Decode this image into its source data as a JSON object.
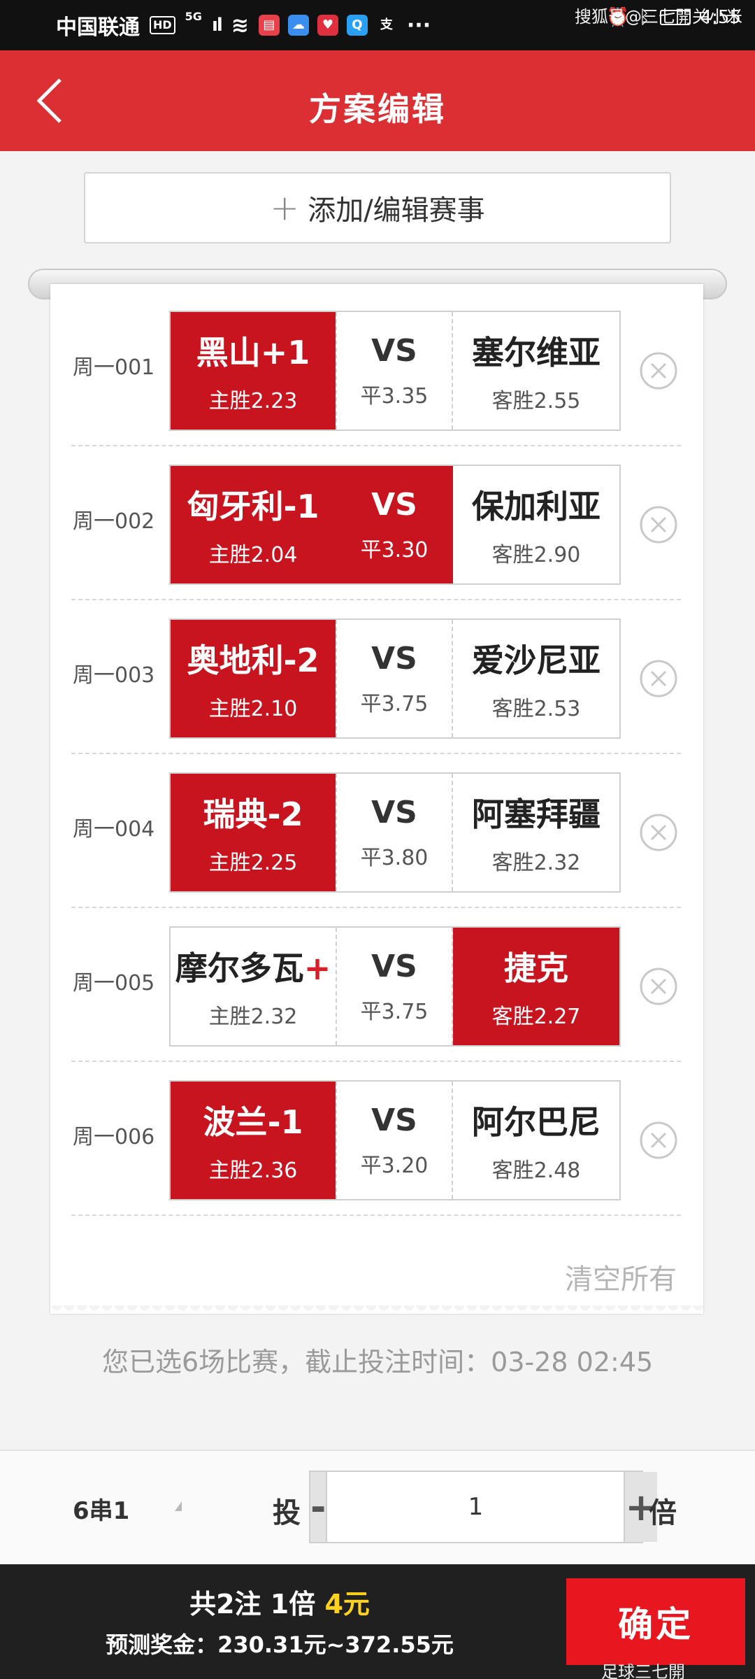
{
  "status_bar": {
    "carrier": "中国联通",
    "hd_badge": "HD",
    "network": "5G",
    "signal": "ıl",
    "wifi": "≋",
    "time": "4:55",
    "watermark": "搜狐号@三七開关小米",
    "apps": [
      {
        "name": "book-app-icon",
        "glyph": "▤",
        "color": "#e8404a"
      },
      {
        "name": "cloud-app-icon",
        "glyph": "☁",
        "color": "#3a8ef0"
      },
      {
        "name": "heart-app-icon",
        "glyph": "♥",
        "color": "#e03040"
      },
      {
        "name": "search-app-icon",
        "glyph": "Q",
        "color": "#2aa0f5"
      },
      {
        "name": "alipay-app-icon",
        "glyph": "支",
        "color": "#111111"
      }
    ],
    "more": "···"
  },
  "header": {
    "title": "方案编辑"
  },
  "add_button": {
    "plus": "+",
    "label": "添加/编辑赛事"
  },
  "matches": [
    {
      "no": "周一001",
      "home": "黑山",
      "handicap": "+1",
      "home_odd": "主胜2.23",
      "vs": "VS",
      "draw_odd": "平3.35",
      "away": "塞尔维亚",
      "away_odd": "客胜2.55",
      "sel_home": true,
      "sel_draw": false,
      "sel_away": false
    },
    {
      "no": "周一002",
      "home": "匈牙利",
      "handicap": "-1",
      "home_odd": "主胜2.04",
      "vs": "VS",
      "draw_odd": "平3.30",
      "away": "保加利亚",
      "away_odd": "客胜2.90",
      "sel_home": true,
      "sel_draw": true,
      "sel_away": false
    },
    {
      "no": "周一003",
      "home": "奥地利",
      "handicap": "-2",
      "home_odd": "主胜2.10",
      "vs": "VS",
      "draw_odd": "平3.75",
      "away": "爱沙尼亚",
      "away_odd": "客胜2.53",
      "sel_home": true,
      "sel_draw": false,
      "sel_away": false
    },
    {
      "no": "周一004",
      "home": "瑞典",
      "handicap": "-2",
      "home_odd": "主胜2.25",
      "vs": "VS",
      "draw_odd": "平3.80",
      "away": "阿塞拜疆",
      "away_odd": "客胜2.32",
      "sel_home": true,
      "sel_draw": false,
      "sel_away": false
    },
    {
      "no": "周一005",
      "home": "摩尔多瓦",
      "handicap": "+",
      "home_odd": "主胜2.32",
      "vs": "VS",
      "draw_odd": "平3.75",
      "away": "捷克",
      "away_odd": "客胜2.27",
      "sel_home": false,
      "sel_draw": false,
      "sel_away": true
    },
    {
      "no": "周一006",
      "home": "波兰",
      "handicap": "-1",
      "home_odd": "主胜2.36",
      "vs": "VS",
      "draw_odd": "平3.20",
      "away": "阿尔巴尼",
      "away_odd": "客胜2.48",
      "sel_home": true,
      "sel_draw": false,
      "sel_away": false
    }
  ],
  "clear_all": "清空所有",
  "info": "您已选6场比赛，截止投注时间：03-28 02:45",
  "multiplier": {
    "pass_type": "6串1",
    "tou": "投",
    "minus": "-",
    "value": "1",
    "plus": "+",
    "bei": "倍"
  },
  "summary": {
    "prefix": "共2注 1倍 ",
    "amount": "4元",
    "prize": "预测奖金：230.31元~372.55元",
    "confirm": "确定",
    "watermark": "足球三七開"
  },
  "colors": {
    "header_red": "#dc2f33",
    "selected_red": "#c8141e",
    "confirm_red": "#e8161f",
    "highlight_yellow": "#ffd21e"
  }
}
